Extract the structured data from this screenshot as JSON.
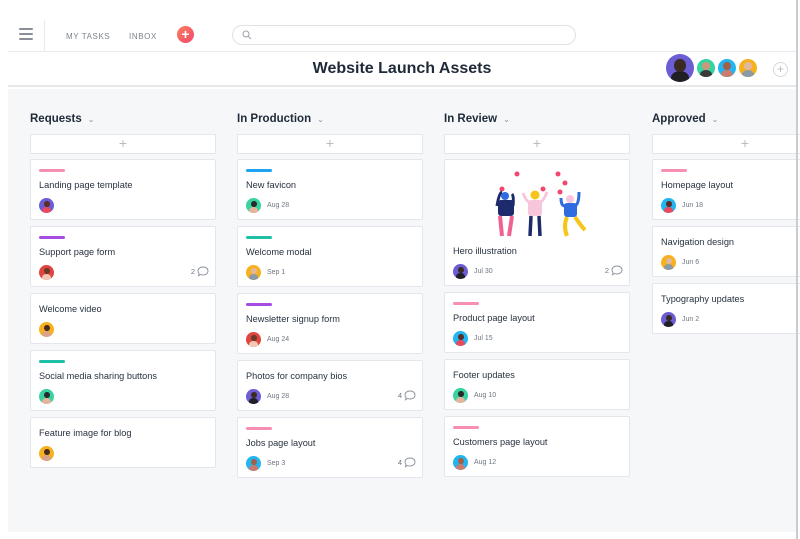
{
  "topbar": {
    "nav": [
      "MY TASKS",
      "INBOX"
    ],
    "add_label": "+",
    "search": {
      "value": "",
      "placeholder": ""
    }
  },
  "project": {
    "title": "Website Launch Assets",
    "members": [
      {
        "name": "member-1",
        "bg": "#6b5dd3",
        "skin": "#3b2a22",
        "shirt": "#1f1f24"
      },
      {
        "name": "member-2",
        "bg": "#37d3a0",
        "skin": "#c99978",
        "shirt": "#3a3a3a"
      },
      {
        "name": "member-3",
        "bg": "#21b6f0",
        "skin": "#a0604a",
        "shirt": "#c97b6f"
      },
      {
        "name": "member-4",
        "bg": "#f6b21e",
        "skin": "#e2b79a",
        "shirt": "#8a9aa6"
      }
    ],
    "add_member_label": "+"
  },
  "colors": {
    "pink": "#f78fb0",
    "purple": "#a74ce0",
    "teal": "#1fc1a6",
    "blue": "#1ea2f2"
  },
  "columns": [
    {
      "title": "Requests",
      "cards": [
        {
          "title": "Landing page template",
          "tag": "#f78fb0",
          "due": "",
          "comments": "",
          "avatar": {
            "bg": "#6b5dd3",
            "skin": "#5a2d25",
            "shirt": "#e94a5d"
          }
        },
        {
          "title": "Support page form",
          "tag": "#a74ce0",
          "due": "",
          "comments": "2",
          "avatar": {
            "bg": "#e0443f",
            "skin": "#6a3a2a",
            "shirt": "#f2c7b4"
          }
        },
        {
          "title": "Welcome video",
          "tag": "",
          "due": "",
          "comments": "",
          "avatar": {
            "bg": "#f6b21e",
            "skin": "#4a2a20",
            "shirt": "#d9a38a"
          }
        },
        {
          "title": "Social media sharing buttons",
          "tag": "#1fc1a6",
          "due": "",
          "comments": "",
          "avatar": {
            "bg": "#37d3a0",
            "skin": "#2a2a2a",
            "shirt": "#e6b49c"
          }
        },
        {
          "title": "Feature image for blog",
          "tag": "",
          "due": "",
          "comments": "",
          "avatar": {
            "bg": "#f6b21e",
            "skin": "#4a2a20",
            "shirt": "#d9a38a"
          }
        }
      ]
    },
    {
      "title": "In Production",
      "cards": [
        {
          "title": "New favicon",
          "tag": "#1ea2f2",
          "due": "Aug 28",
          "comments": "",
          "avatar": {
            "bg": "#37d3a0",
            "skin": "#2a2a2a",
            "shirt": "#e6b49c"
          }
        },
        {
          "title": "Welcome modal",
          "tag": "#1fc1a6",
          "due": "Sep 1",
          "comments": "",
          "avatar": {
            "bg": "#f6b21e",
            "skin": "#e2b79a",
            "shirt": "#8a9aa6"
          }
        },
        {
          "title": "Newsletter signup form",
          "tag": "#a74ce0",
          "due": "Aug 24",
          "comments": "",
          "avatar": {
            "bg": "#e0443f",
            "skin": "#6a3a2a",
            "shirt": "#f2c7b4"
          }
        },
        {
          "title": "Photos for company bios",
          "tag": "",
          "due": "Aug 28",
          "comments": "4",
          "avatar": {
            "bg": "#6b5dd3",
            "skin": "#3b2a22",
            "shirt": "#1f1f24"
          }
        },
        {
          "title": "Jobs page layout",
          "tag": "#f78fb0",
          "due": "Sep 3",
          "comments": "4",
          "avatar": {
            "bg": "#21b6f0",
            "skin": "#a0604a",
            "shirt": "#c97b6f"
          }
        }
      ]
    },
    {
      "title": "In Review",
      "cards": [
        {
          "title": "Hero illustration",
          "tag": "",
          "image": "hero-illustration",
          "due": "Jul 30",
          "comments": "2",
          "avatar": {
            "bg": "#6b5dd3",
            "skin": "#3b2a22",
            "shirt": "#1f1f24"
          }
        },
        {
          "title": "Product page layout",
          "tag": "#f78fb0",
          "due": "Jul 15",
          "comments": "",
          "avatar": {
            "bg": "#21b6f0",
            "skin": "#5a2d25",
            "shirt": "#e94a5d"
          }
        },
        {
          "title": "Footer updates",
          "tag": "",
          "due": "Aug 10",
          "comments": "",
          "avatar": {
            "bg": "#37d3a0",
            "skin": "#2a2a2a",
            "shirt": "#e6b49c"
          }
        },
        {
          "title": "Customers page layout",
          "tag": "#f78fb0",
          "due": "Aug 12",
          "comments": "",
          "avatar": {
            "bg": "#21b6f0",
            "skin": "#a0604a",
            "shirt": "#c97b6f"
          }
        }
      ]
    },
    {
      "title": "Approved",
      "cards": [
        {
          "title": "Homepage layout",
          "tag": "#f78fb0",
          "due": "Jun 18",
          "comments": "",
          "avatar": {
            "bg": "#21b6f0",
            "skin": "#5a2d25",
            "shirt": "#e94a5d"
          }
        },
        {
          "title": "Navigation design",
          "tag": "",
          "due": "Jun 6",
          "comments": "",
          "avatar": {
            "bg": "#f6b21e",
            "skin": "#e2b79a",
            "shirt": "#8a9aa6"
          }
        },
        {
          "title": "Typography updates",
          "tag": "",
          "due": "Jun 2",
          "comments": "",
          "avatar": {
            "bg": "#6b5dd3",
            "skin": "#3b2a22",
            "shirt": "#1f1f24"
          }
        }
      ]
    }
  ],
  "labels": {
    "add_card": "+",
    "chevron": "⌄"
  }
}
